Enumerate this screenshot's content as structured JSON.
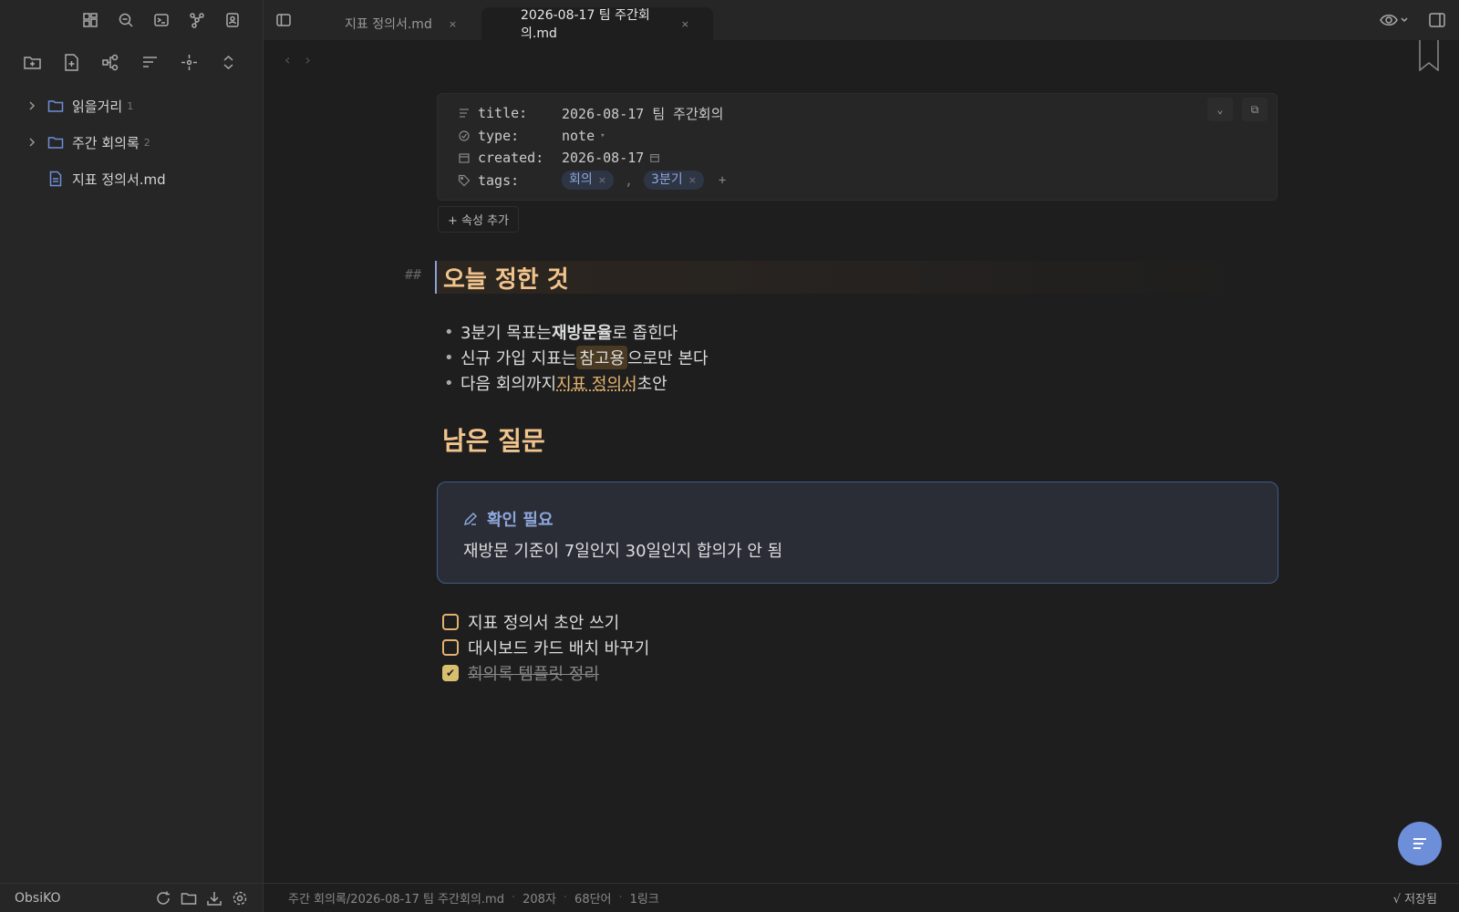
{
  "sidebar": {
    "tree": [
      {
        "label": "읽을거리",
        "count": "1"
      },
      {
        "label": "주간 회의록",
        "count": "2"
      },
      {
        "label": "지표 정의서.md"
      }
    ],
    "vault_name": "ObsiKO"
  },
  "tabs": [
    {
      "label": "지표 정의서.md"
    },
    {
      "label": "2026-08-17 팀 주간회의.md"
    }
  ],
  "properties": {
    "title": {
      "key": "title:",
      "value": "2026-08-17 팀 주간회의"
    },
    "type": {
      "key": "type:",
      "value": "note"
    },
    "created": {
      "key": "created:",
      "value": "2026-08-17"
    },
    "tags": {
      "key": "tags:",
      "values": [
        "회의",
        "3분기"
      ]
    },
    "add_label": "+ 속성 추가"
  },
  "content": {
    "heading1": "오늘 정한 것",
    "heading_marker": "##",
    "bullets": [
      {
        "pre": "3분기 목표는 ",
        "bold": "재방문율",
        "post": "로 좁힌다"
      },
      {
        "pre": "신규 가입 지표는 ",
        "highlight": "참고용",
        "post": "으로만 본다"
      },
      {
        "pre": "다음 회의까지 ",
        "link": "지표 정의서",
        "post": " 초안"
      }
    ],
    "heading2": "남은 질문",
    "callout": {
      "title": "확인 필요",
      "body": "재방문 기준이 7일인지 30일인지 합의가 안 됨"
    },
    "tasks": [
      {
        "text": "지표 정의서 초안 쓰기",
        "done": false
      },
      {
        "text": "대시보드 카드 배치 바꾸기",
        "done": false
      },
      {
        "text": "회의록 템플릿 정리",
        "done": true
      }
    ]
  },
  "status": {
    "path": "주간 회의록/2026-08-17 팀 주간회의.md",
    "chars": "208자",
    "words": "68단어",
    "links": "1링크",
    "saved": "√ 저장됨"
  },
  "colors": {
    "accent": "#6d8ed9",
    "heading": "#f2c48d",
    "link": "#e3b26f"
  }
}
